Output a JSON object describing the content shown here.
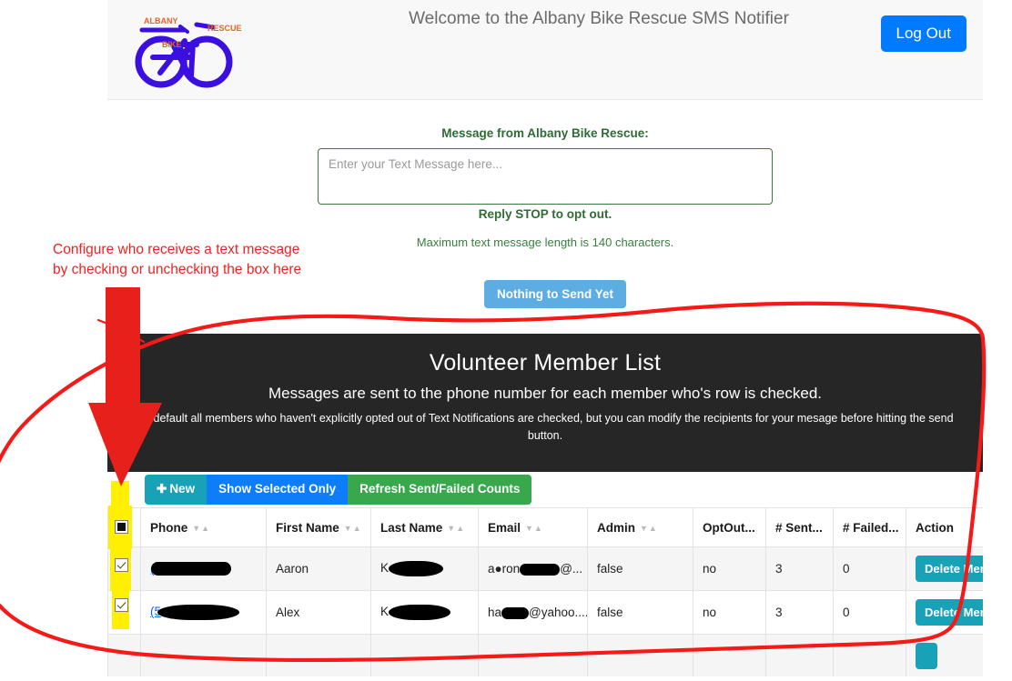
{
  "header": {
    "logo_alt": "Albany Bike Rescue logo",
    "logo_text_top_left": "ALBANY",
    "logo_text_top_right": "RESCUE",
    "logo_text_middle": "BIKE",
    "welcome_title": "Welcome to the Albany Bike Rescue SMS Notifier",
    "logout_label": "Log Out",
    "logout_color": "#007bff"
  },
  "message_form": {
    "label": "Message from Albany Bike Rescue:",
    "textarea_value": "",
    "textarea_placeholder": "Enter your Text Message here...",
    "opt_out_note": "Reply STOP to opt out.",
    "max_length_note": "Maximum text message length is 140 characters.",
    "send_button_label": "Nothing to Send Yet",
    "send_button_color": "#5dade2",
    "label_color": "#2f6b34"
  },
  "banner": {
    "title": "Volunteer Member List",
    "subtitle": "Messages are sent to the phone number for each member who's row is checked.",
    "note": "By default all members who haven't explicitly opted out of Text Notifications are checked, but you can modify the recipients for your mesage before hitting the send button.",
    "background_color": "#262626"
  },
  "toolbar": {
    "new_label": "New",
    "new_icon": "plus-icon",
    "new_color": "#17a2b8",
    "show_selected_label": "Show Selected Only",
    "show_selected_color": "#0d7dfa",
    "refresh_label": "Refresh Sent/Failed Counts",
    "refresh_color": "#39a84d"
  },
  "table": {
    "columns": [
      {
        "label": "",
        "sortable": false,
        "key": "check"
      },
      {
        "label": "Phone",
        "sortable": true,
        "key": "phone"
      },
      {
        "label": "First Name",
        "sortable": true,
        "key": "first"
      },
      {
        "label": "Last Name",
        "sortable": true,
        "key": "last"
      },
      {
        "label": "Email",
        "sortable": true,
        "key": "email"
      },
      {
        "label": "Admin",
        "sortable": true,
        "key": "admin"
      },
      {
        "label": "OptOut...",
        "sortable": false,
        "key": "optout"
      },
      {
        "label": "# Sent...",
        "sortable": false,
        "key": "sent"
      },
      {
        "label": "# Failed...",
        "sortable": false,
        "key": "failed"
      },
      {
        "label": "Action",
        "sortable": false,
        "key": "action"
      }
    ],
    "header_checkbox_state": "indeterminate",
    "sort_arrows_glyph": "▼▲",
    "rows": [
      {
        "checked": true,
        "phone_visible": "(",
        "phone_redacted": true,
        "first_name": "Aaron",
        "last_name_visible": "K",
        "last_name_redacted": true,
        "email_visible": "a●ron",
        "email_suffix": "@...",
        "admin": "false",
        "optout": "no",
        "sent": "3",
        "failed": "0",
        "action_label": "Delete Member"
      },
      {
        "checked": true,
        "phone_visible": "(5",
        "phone_redacted": true,
        "first_name": "Alex",
        "last_name_visible": "K",
        "last_name_redacted": true,
        "email_visible": "ha",
        "email_suffix": "@yahoo....",
        "admin": "false",
        "optout": "no",
        "sent": "3",
        "failed": "0",
        "action_label": "Delete Member"
      }
    ],
    "delete_button_color": "#17a2b8"
  },
  "annotations": {
    "instruction_text_line1": "Configure who receives a text message",
    "instruction_text_line2": "by checking or unchecking the box here",
    "annotation_color": "#ee2222",
    "highlight_color": "#ffef00",
    "arrow_direction": "down",
    "circle_shape": "hand-drawn-oval"
  }
}
